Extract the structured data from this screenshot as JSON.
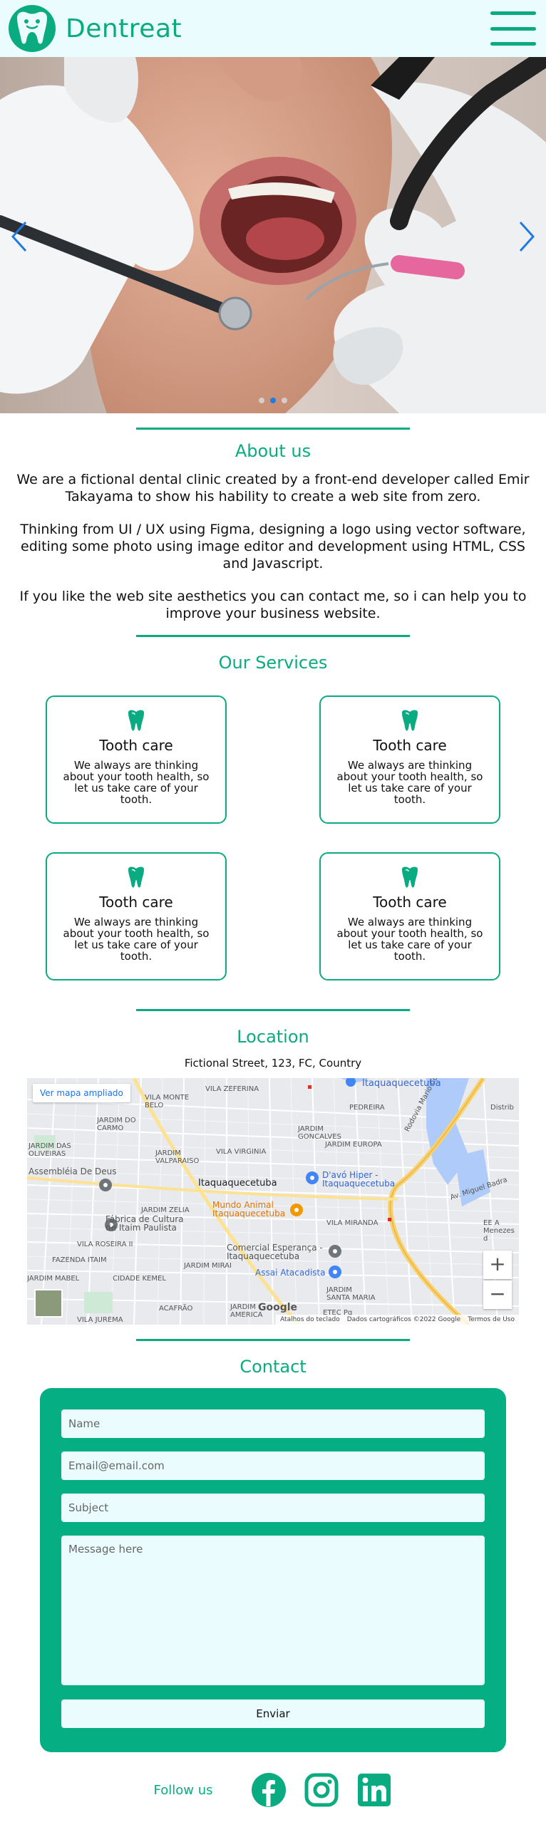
{
  "header": {
    "brand": "Dentreat",
    "menu_icon": "hamburger-icon"
  },
  "hero": {
    "slides": 3,
    "active_slide": 2,
    "image": "dentist-examining-patient-photo"
  },
  "about": {
    "title": "About us",
    "paragraphs": [
      "We are a fictional dental clinic created by a front-end developer called Emir Takayama to show his hability to create a web site from zero.",
      "Thinking from UI / UX using Figma, designing a logo using vector software, editing some photo using image editor and development using HTML, CSS and Javascript.",
      "If you like the web site aesthetics you can contact me, so i can help you to improve your business website."
    ]
  },
  "services": {
    "title": "Our Services",
    "cards": [
      {
        "icon": "tooth-icon",
        "title": "Tooth care",
        "text": "We always are thinking about your tooth health, so let us take care of your tooth."
      },
      {
        "icon": "tooth-icon",
        "title": "Tooth care",
        "text": "We always are thinking about your tooth health, so let us take care of your tooth."
      },
      {
        "icon": "tooth-icon",
        "title": "Tooth care",
        "text": "We always are thinking about your tooth health, so let us take care of your tooth."
      },
      {
        "icon": "tooth-icon",
        "title": "Tooth care",
        "text": "We always are thinking about your tooth health, so let us take care of your tooth."
      }
    ]
  },
  "location": {
    "title": "Location",
    "address": "Fictional Street, 123, FC, Country",
    "map": {
      "link": "Ver mapa ampliado",
      "labels": [
        "VILA ZEFERINA",
        "Itaquaquecetuba",
        "VILA MONTE BELO",
        "PEDREIRA",
        "JARDIM DO CARMO",
        "JARDIM GONCALVES",
        "JARDIM EUROPA",
        "JARDIM DAS OLIVEIRAS",
        "JARDIM VALPARAISO",
        "VILA VIRGINIA",
        "Assembléia De Deus",
        "Itaquaquecetuba",
        "D'avó Hiper - Itaquaquecetuba",
        "Mundo Animal Itaquaquecetuba",
        "JARDIM ZELIA",
        "Fábrica de Cultura de Itaim Paulista",
        "VILA MIRANDA",
        "VILA ROSEIRA II",
        "Comercial Esperança - Itaquaquecetuba",
        "FAZENDA ITAIM",
        "JARDIM MIRAI",
        "Assai Atacadista",
        "JARDIM MABEL",
        "CIDADE KEMEL",
        "JARDIM SANTA MARIA",
        "ACAFRÃO",
        "JARDIM AMERICA",
        "VILA JUREMA",
        "ETEC Pq",
        "Distrib",
        "Rodovia Mario Covas",
        "Av. Miguel Badra",
        "EE A Menezes d"
      ],
      "zoom_in": "+",
      "zoom_out": "−",
      "google": "Google",
      "footer": [
        "Atalhos do teclado",
        "Dados cartográficos ©2022 Google",
        "Termos de Uso"
      ]
    }
  },
  "contact": {
    "title": "Contact",
    "name_placeholder": "Name",
    "email_placeholder": "Email@email.com",
    "subject_placeholder": "Subject",
    "message_placeholder": "Message here",
    "submit": "Enviar"
  },
  "follow": {
    "label": "Follow us",
    "networks": [
      "facebook-icon",
      "instagram-icon",
      "linkedin-icon"
    ]
  },
  "colors": {
    "brand": "#0aab80",
    "header_bg": "#eafcfd",
    "form_bg": "#05ae83",
    "carousel_active": "#1f7be0"
  }
}
